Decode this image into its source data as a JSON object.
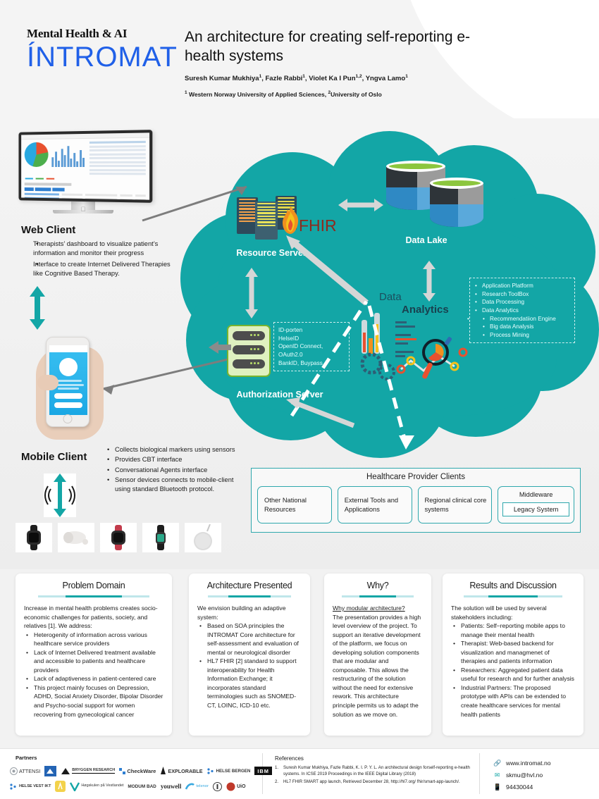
{
  "header": {
    "logo_top": "Mental Health & AI",
    "logo_main": "ÍNTROMAT",
    "title": "An architecture for creating self-reporting e-health systems",
    "authors": "Suresh Kumar Mukhiya¹, Fazle Rabbi¹, Violet Ka I Pun¹,², Yngva Lamo¹",
    "affiliations": "¹ Western Norway University of Applied Sciences, ²University of Oslo"
  },
  "web_client": {
    "title": "Web Client",
    "bullets": [
      "Therapists’ dashboard to visualize patient’s information and monitor their progress",
      "Interface to create Internet Delivered Therapies like Cognitive Based Therapy."
    ]
  },
  "mobile_client": {
    "title": "Mobile Client",
    "bullets": [
      "Collects biological markers using sensors",
      "Provides CBT interface",
      "Conversational Agents interface",
      "Sensor devices connects to mobile-client using standard Bluetooth protocol."
    ],
    "devices": [
      "smartwatch",
      "vr-headset",
      "apple-watch",
      "fitness-band",
      "smart-speaker"
    ]
  },
  "cloud": {
    "resource_server_label": "Resource Server",
    "fhir_label": "FHIR",
    "data_lake_label": "Data Lake",
    "analytics_label_1": "Data",
    "analytics_label_2": "Analytics",
    "authorization_server_label": "Authorization Server",
    "auth_protocols": [
      "ID-porten",
      "HelseID",
      "OpenID Connect,",
      "OAuth2.0",
      "BankID, Buypass"
    ],
    "analytics_items": [
      "Application Platform",
      "Research ToolBox",
      "Data Processing",
      "Data Analytics"
    ],
    "analytics_subitems": [
      "Recommendatiion Engine",
      "Big data Analysis",
      "Process Mining"
    ]
  },
  "healthcare_provider": {
    "title": "Healthcare Provider Clients",
    "cards": [
      "Other National Resources",
      "External Tools and Applications",
      "Regional clinical core systems"
    ],
    "middleware_label": "Middleware",
    "legacy_label": "Legacy System"
  },
  "panels": [
    {
      "title": "Problem Domain",
      "intro": "Increase in mental health problems creates socio-economic challenges for patients, society, and relatives [1]. We address:",
      "bullets": [
        "Heterogenity of information across various healthcare service providers",
        "Lack of Internet Delivered treatment available and accessible to patients and healthcare providers",
        "Lack of adaptiveness in patient-centered care",
        "This project mainly focuses on Depression, ADHD, Social Anxiety Disorder, Bipolar Disorder and Psycho-social support for women recovering from gynecological cancer"
      ]
    },
    {
      "title": "Architecture Presented",
      "intro": "We envision building an adaptive system:",
      "bullets": [
        "Based on SOA principles the INTROMAT Core architecture for self-assessment and evaluation of mental or neurological disorder",
        "HL7 FHIR [2] standard to support interoperability for Health Information Exchange; it incorporates standard terminologies such as SNOMED-CT, LOINC, ICD-10 etc."
      ]
    },
    {
      "title": "Why?",
      "subheading": "Why modular architecture?",
      "intro": "The presentation provides a high level overview of the project. To support an iterative development of the platform, we focus on developing solution components that are modular and composable. This allows the restructuring of the solution without the need for extensive rework. This architecture principle permits us to adapt the solution as we move on.",
      "bullets": []
    },
    {
      "title": "Results and Discussion",
      "intro": "The solution will be used by several stakeholders including:",
      "bullets": [
        "Patients: Self−reporting mobile apps to manage their mental health",
        "Therapist: Web-based backend for visualization and managmenet of therapies and patients information",
        "Researchers: Aggregated patient data useful for research and for further analysis",
        "Industrial Partners: The proposed prototype with APIs can be extended to create healthcare services for mental health patients"
      ]
    }
  ],
  "footer": {
    "partners_label": "Partners",
    "partner_logos_row1": [
      "ATTENSI",
      "UNI",
      "BRYGGEN RESEARCH",
      "CheckWare",
      "EXPLORABLE",
      "HELSE BERGEN",
      "IBM"
    ],
    "partner_logos_row2": [
      "HELSE VEST IKT",
      "Anatta",
      "Høgskulen på Vestlandet",
      "MODUM BAD",
      "youwell",
      "telenor",
      "NTNU",
      "UiO"
    ],
    "references_title": "References",
    "references": [
      {
        "num": "1.",
        "text": "Suresh Kumar Mukhiya, Fazle Rabbi, K. I. P. Y. L. An architectural design forself-reporting e-health systems. In ICSE 2019 Proceedings in the IEEE Digital Library (2018)"
      },
      {
        "num": "2.",
        "text": "HL7 FHIR SMART app launch, Retrieved December 28, http://hl7.org/ fhir/smart-app-launch/."
      }
    ],
    "contact": [
      {
        "icon": "link-icon",
        "text": "www.intromat.no"
      },
      {
        "icon": "mail-icon",
        "text": "skmu@hvl.no"
      },
      {
        "icon": "phone-icon",
        "text": "94430044"
      }
    ]
  },
  "colors": {
    "teal": "#13a6a6",
    "brand_blue": "#2060e8",
    "green": "#8cc63e",
    "dark_red": "#8e2a1e"
  }
}
